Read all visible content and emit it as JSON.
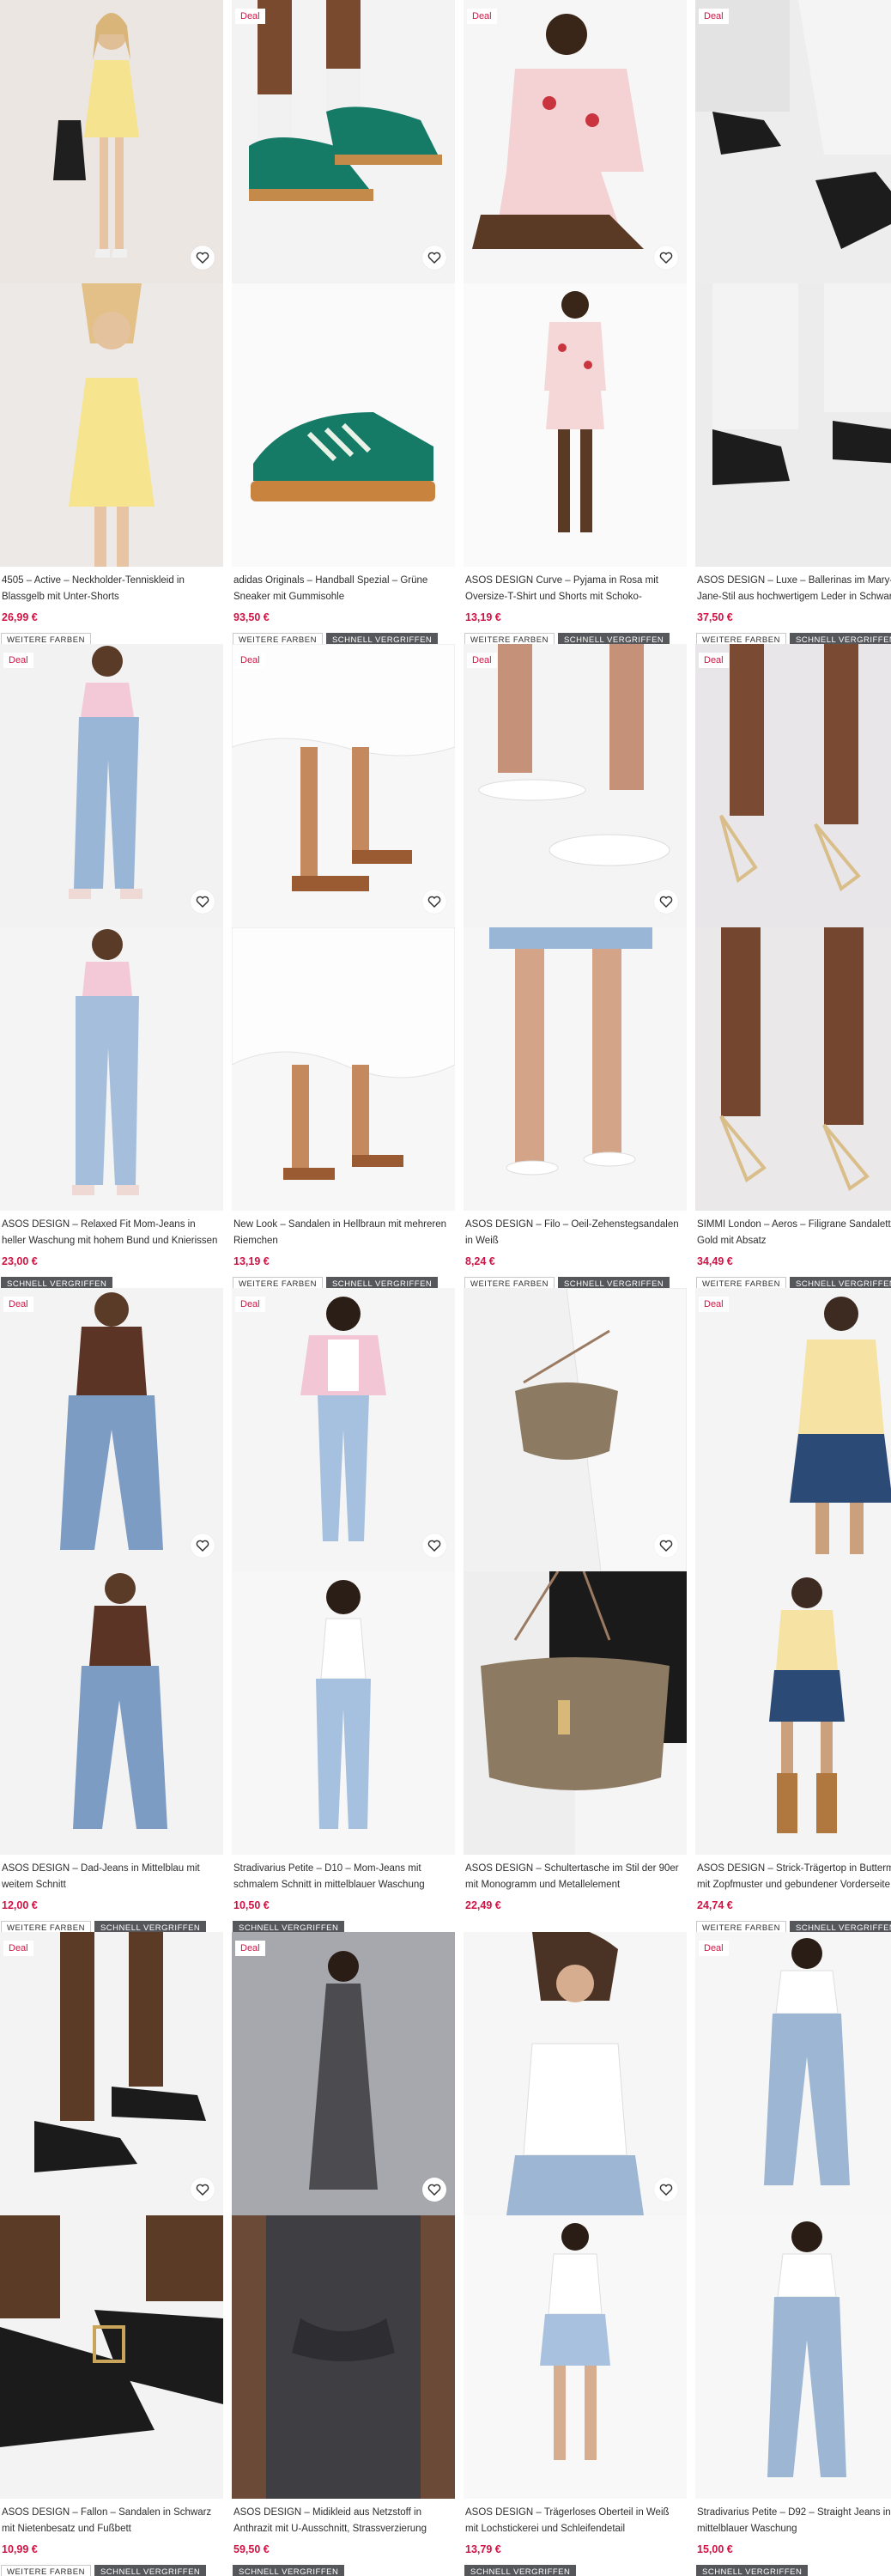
{
  "labels": {
    "deal": "Deal",
    "more_colors": "WEITERE FARBEN",
    "selling_fast": "SCHNELL VERGRIFFEN"
  },
  "icons": {
    "wishlist": "heart-icon"
  },
  "colors": {
    "deal": "#d01345",
    "price": "#d01345",
    "badge_dark": "#56575b"
  },
  "products": [
    {
      "title": "4505 – Active – Neckholder-Tenniskleid in Blassgelb mit Unter-Shorts",
      "price": "26,99 €",
      "deal": false,
      "badges": [
        "more"
      ],
      "scene": "dress"
    },
    {
      "title": "adidas Originals – Handball Spezial – Grüne Sneaker mit Gummisohle",
      "price": "93,50 €",
      "deal": true,
      "badges": [
        "more",
        "fast"
      ],
      "scene": "sneaker"
    },
    {
      "title": "ASOS DESIGN Curve – Pyjama in Rosa mit Oversize-T-Shirt und Shorts mit Schoko-Erdbeer-...",
      "price": "13,19 €",
      "deal": true,
      "badges": [
        "more",
        "fast"
      ],
      "scene": "pyjama"
    },
    {
      "title": "ASOS DESIGN – Luxe – Ballerinas im Mary-Jane-Stil aus hochwertigem Leder in Schwarz",
      "price": "37,50 €",
      "deal": true,
      "badges": [
        "more",
        "fast"
      ],
      "scene": "maryjane"
    },
    {
      "title": "ASOS DESIGN – Relaxed Fit Mom-Jeans in heller Waschung mit hohem Bund und Knierissen",
      "price": "23,00 €",
      "deal": true,
      "badges": [
        "fast"
      ],
      "scene": "jeans-light"
    },
    {
      "title": "New Look – Sandalen in Hellbraun mit mehreren Riemchen",
      "price": "13,19 €",
      "deal": true,
      "badges": [
        "more",
        "fast"
      ],
      "scene": "sandal-brown"
    },
    {
      "title": "ASOS DESIGN – Filo – Oeil-Zehenstegsandalen in Weiß",
      "price": "8,24 €",
      "deal": true,
      "badges": [
        "more",
        "fast"
      ],
      "scene": "flipflop"
    },
    {
      "title": "SIMMI London – Aeros – Filigrane Sandaletten in Gold mit Absatz",
      "price": "34,49 €",
      "deal": true,
      "badges": [
        "more",
        "fast"
      ],
      "scene": "heels"
    },
    {
      "title": "ASOS DESIGN – Dad-Jeans in Mittelblau mit weitem Schnitt",
      "price": "12,00 €",
      "deal": true,
      "badges": [
        "more",
        "fast"
      ],
      "scene": "jeans-wide"
    },
    {
      "title": "Stradivarius Petite – D10 – Mom-Jeans mit schmalem Schnitt in mittelblauer Waschung",
      "price": "10,50 €",
      "deal": true,
      "badges": [
        "fast"
      ],
      "scene": "jeans-petite"
    },
    {
      "title": "ASOS DESIGN – Schultertasche im Stil der 90er mit Monogramm und Metallelement",
      "price": "22,49 €",
      "deal": false,
      "badges": [
        "more",
        "fast"
      ],
      "scene": "bag"
    },
    {
      "title": "ASOS DESIGN – Strick-Trägertop in Buttermilch mit Zopfmuster und gebundener Vorderseite",
      "price": "24,74 €",
      "deal": true,
      "badges": [
        "more",
        "fast"
      ],
      "scene": "knit"
    },
    {
      "title": "ASOS DESIGN – Fallon – Sandalen in Schwarz mit Nietenbesatz und Fußbett",
      "price": "10,99 €",
      "deal": true,
      "badges": [
        "more",
        "fast"
      ],
      "scene": "studded"
    },
    {
      "title": "ASOS DESIGN – Midikleid aus Netzstoff in Anthrazit mit U-Ausschnitt, Strassverzierung und...",
      "price": "59,50 €",
      "deal": true,
      "badges": [
        "fast"
      ],
      "scene": "mesh"
    },
    {
      "title": "ASOS DESIGN – Trägerloses Oberteil in Weiß mit Lochstickerei und Schleifendetail",
      "price": "13,79 €",
      "deal": false,
      "badges": [
        "fast"
      ],
      "scene": "tubetop"
    },
    {
      "title": "Stradivarius Petite – D92 – Straight Jeans in mittelblauer Waschung",
      "price": "15,00 €",
      "deal": true,
      "badges": [
        "fast"
      ],
      "scene": "straight"
    }
  ]
}
